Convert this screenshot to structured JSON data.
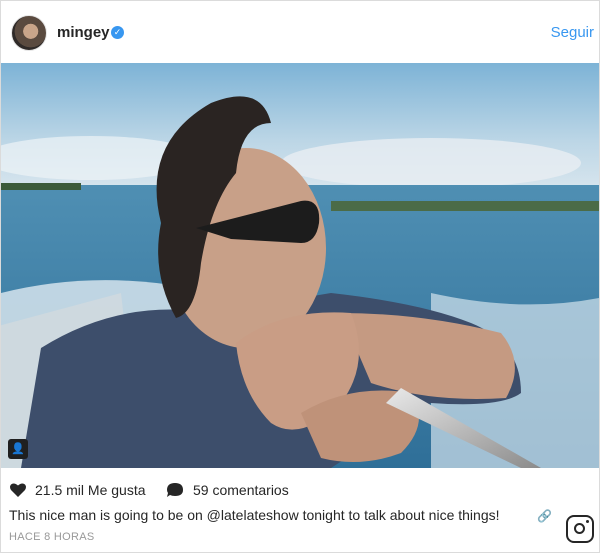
{
  "post": {
    "username": "mingey",
    "follow_label": "Seguir",
    "likes": "21.5 mil Me gusta",
    "comments": "59 comentarios",
    "caption": "This nice man is going to be on @latelateshow tonight to talk about nice things!",
    "time": "HACE 8 HORAS"
  },
  "icons": {
    "verified": "verified-badge-icon",
    "like": "heart-icon",
    "comment": "comment-bubble-icon",
    "tag": "user-tag-icon",
    "link": "link-icon",
    "logo": "instagram-logo-icon"
  },
  "colors": {
    "accent": "#3897f0",
    "text": "#262626",
    "muted": "#999999",
    "border": "#dbdbdb"
  }
}
